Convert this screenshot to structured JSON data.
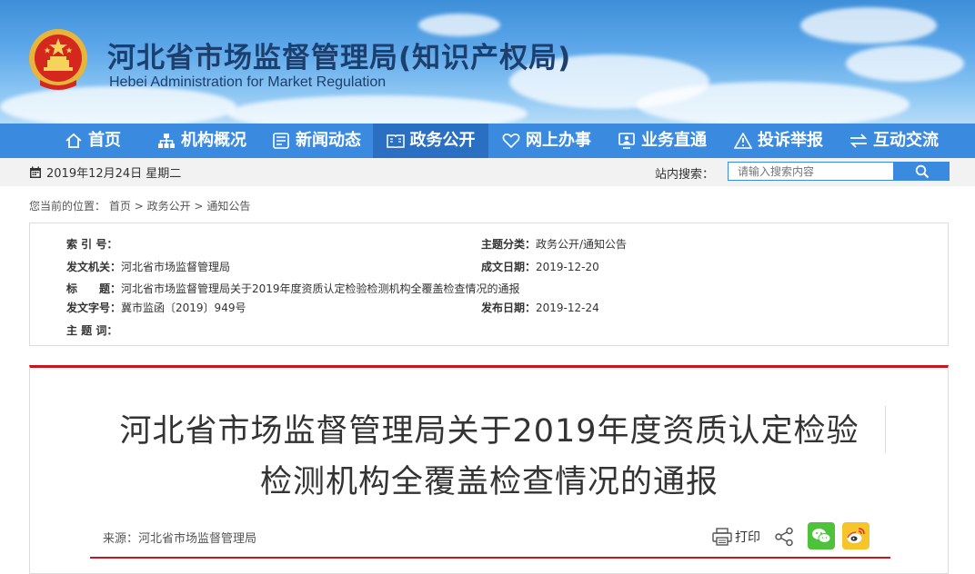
{
  "header": {
    "title": "河北省市场监督管理局(知识产权局)",
    "subtitle": "Hebei Administration for Market Regulation",
    "emblem_icon": "national-emblem"
  },
  "nav": {
    "items": [
      {
        "label": "首页",
        "icon": "home-icon"
      },
      {
        "label": "机构概况",
        "icon": "org-chart-icon"
      },
      {
        "label": "新闻动态",
        "icon": "news-icon"
      },
      {
        "label": "政务公开",
        "icon": "open-gov-icon",
        "active": true
      },
      {
        "label": "网上办事",
        "icon": "heart-icon"
      },
      {
        "label": "业务直通",
        "icon": "monitor-user-icon"
      },
      {
        "label": "投诉举报",
        "icon": "warning-icon"
      },
      {
        "label": "互动交流",
        "icon": "exchange-icon"
      }
    ],
    "active_color": "#2a6fc2",
    "bar_color": "#3a8ae0"
  },
  "datebar": {
    "date": "2019年12月24日 星期二",
    "search_label": "站内搜索：",
    "search_placeholder": "请输入搜索内容"
  },
  "breadcrumb": {
    "prefix": "您当前的位置：",
    "items": [
      "首页",
      "政务公开",
      "通知公告"
    ],
    "separator": ">"
  },
  "meta": {
    "index_label": "索 引 号：",
    "index_value": "",
    "category_label": "主题分类：",
    "category_value": "政务公开/通知公告",
    "issuer_label": "发文机关：",
    "issuer_value": "河北省市场监督管理局",
    "written_label": "成文日期：",
    "written_value": "2019-12-20",
    "title_label": "标　　题：",
    "title_value": "河北省市场监督管理局关于2019年度资质认定检验检测机构全覆盖检查情况的通报",
    "docno_label": "发文字号：",
    "docno_value": "冀市监函〔2019〕949号",
    "published_label": "发布日期：",
    "published_value": "2019-12-24",
    "keywords_label": "主 题 词：",
    "keywords_value": ""
  },
  "article": {
    "title_line1": "河北省市场监督管理局关于2019年度资质认定检验",
    "title_line2": "检测机构全覆盖检查情况的通报",
    "source": "来源：河北省市场监督管理局",
    "print_label": "打印",
    "accent_color": "#c8161e"
  }
}
